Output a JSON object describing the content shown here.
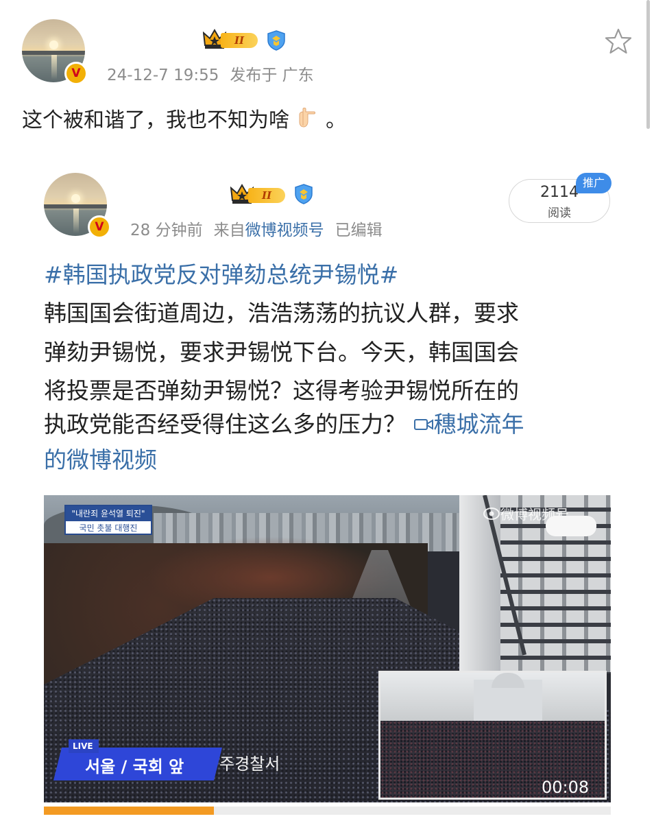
{
  "post": {
    "timestamp": "24-12-7 19:55",
    "location": "发布于 广东",
    "vip_level": "II",
    "text": "这个被和谐了，我也不知为啥",
    "text_suffix": "。",
    "emoji_icon": "pointing-down-hand-emoji"
  },
  "repost": {
    "vip_level": "II",
    "time_ago": "28 分钟前",
    "source_prefix": "来自",
    "source": "微博视频号",
    "edited": "已编辑",
    "read_count": "2114",
    "read_label": "阅读",
    "promo_badge": "推广",
    "topic": "#韩国执政党反对弹劾总统尹锡悦#",
    "lines": [
      "韩国国会街道周边，浩浩荡荡的抗议人群，要求",
      "弹劾尹锡悦，要求尹锡悦下台。今天，韩国国会",
      "将投票是否弹劾尹锡悦？这得考验尹锡悦所在的",
      "执政党能否经受得住这么多的压力？"
    ],
    "video_link_part1": "穗城流年",
    "video_link_part2": "的微博视频"
  },
  "video": {
    "banner_top": "\"내란죄 윤석열 퇴진\"",
    "banner_bottom": "국민 촛불 대행진",
    "watermark": "微博视频号",
    "live_tag": "LIVE",
    "location": "서울 / 국회 앞",
    "police_text": "주경찰서",
    "duration": "00:08",
    "progress": 0.3
  },
  "colors": {
    "link": "#3a6fa8",
    "meta": "#8c8c8c",
    "promo": "#3e8ce8",
    "progress": "#f39a22",
    "live_blue": "#2e46d8"
  }
}
